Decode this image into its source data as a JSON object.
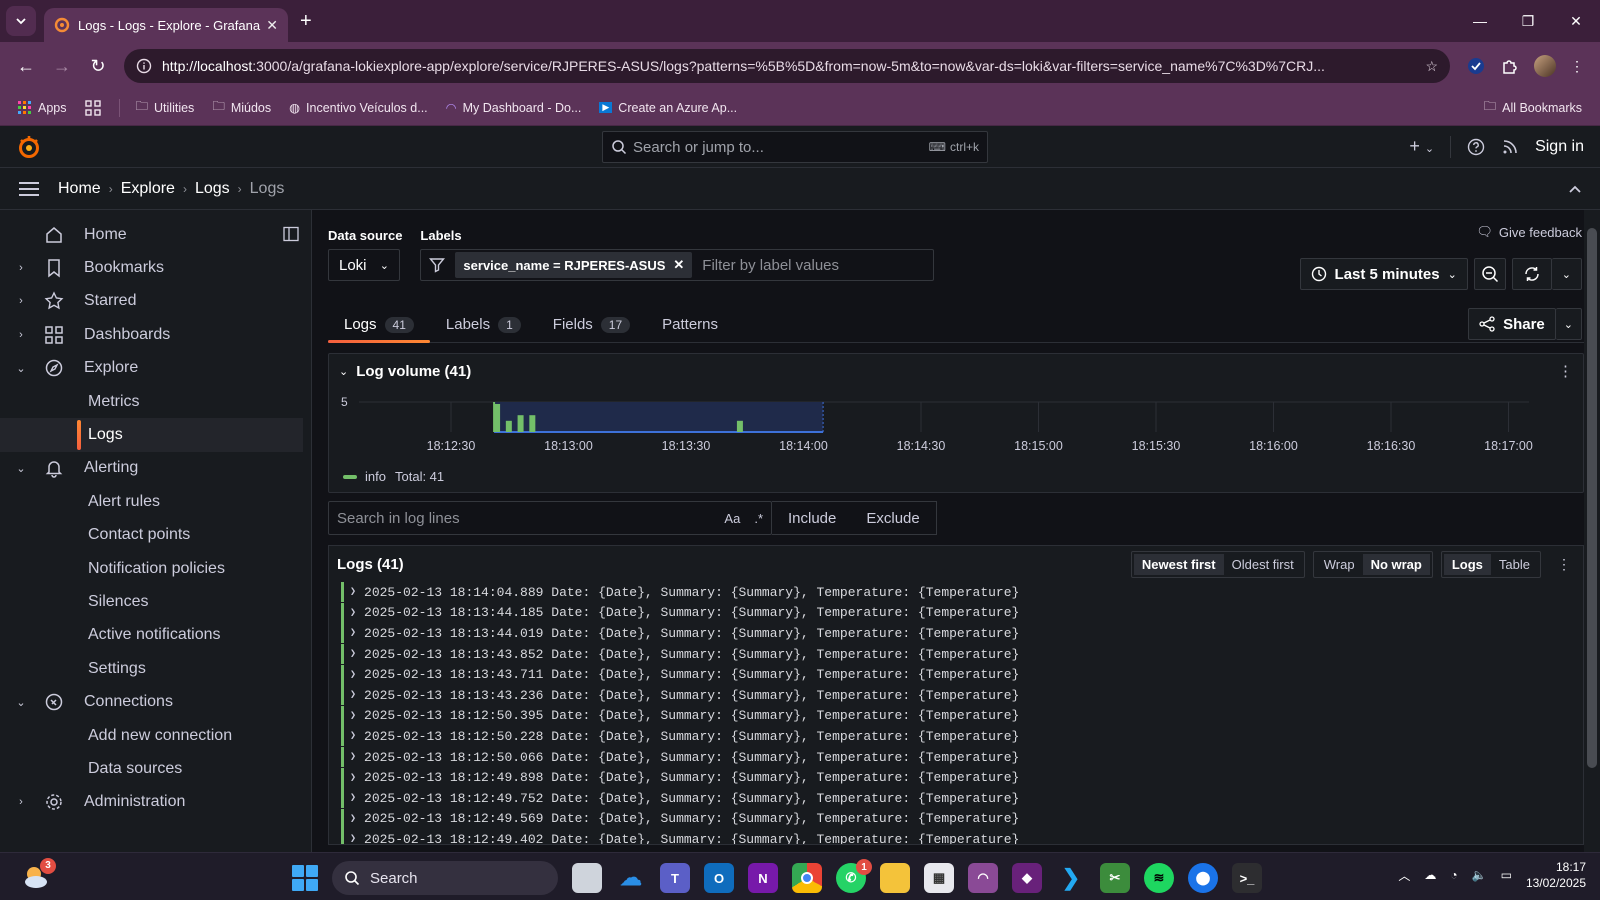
{
  "browser": {
    "tab_title": "Logs - Logs - Explore - Grafana",
    "url_host": "http://localhost",
    "url_rest": ":3000/a/grafana-lokiexplore-app/explore/service/RJPERES-ASUS/logs?patterns=%5B%5D&from=now-5m&to=now&var-ds=loki&var-filters=service_name%7C%3D%7CRJ...",
    "bookmarks": [
      "Apps",
      "Utilities",
      "Miúdos",
      "Incentivo Veículos d...",
      "My Dashboard - Do...",
      "Create an Azure Ap..."
    ],
    "all_bookmarks": "All Bookmarks"
  },
  "header": {
    "search_placeholder": "Search or jump to...",
    "shortcut": "ctrl+k",
    "sign_in": "Sign in"
  },
  "breadcrumb": [
    "Home",
    "Explore",
    "Logs",
    "Logs"
  ],
  "sidebar": {
    "items": [
      {
        "label": "Home",
        "icon": "home-icon",
        "chev": ""
      },
      {
        "label": "Bookmarks",
        "icon": "bookmark-icon",
        "chev": "›"
      },
      {
        "label": "Starred",
        "icon": "star-icon",
        "chev": "›"
      },
      {
        "label": "Dashboards",
        "icon": "apps-icon",
        "chev": "›"
      },
      {
        "label": "Explore",
        "icon": "compass-icon",
        "chev": "⌄"
      },
      {
        "label": "Metrics",
        "sub": true
      },
      {
        "label": "Logs",
        "sub": true,
        "active": true
      },
      {
        "label": "Alerting",
        "icon": "bell-icon",
        "chev": "⌄"
      },
      {
        "label": "Alert rules",
        "sub": true
      },
      {
        "label": "Contact points",
        "sub": true
      },
      {
        "label": "Notification policies",
        "sub": true
      },
      {
        "label": "Silences",
        "sub": true
      },
      {
        "label": "Active notifications",
        "sub": true
      },
      {
        "label": "Settings",
        "sub": true
      },
      {
        "label": "Connections",
        "icon": "plug-icon",
        "chev": "⌄"
      },
      {
        "label": "Add new connection",
        "sub": true
      },
      {
        "label": "Data sources",
        "sub": true
      },
      {
        "label": "Administration",
        "icon": "cog-icon",
        "chev": "›"
      }
    ]
  },
  "main": {
    "give_feedback": "Give feedback",
    "datasource_label": "Data source",
    "datasource_value": "Loki",
    "labels_label": "Labels",
    "filter_chip": "service_name = RJPERES-ASUS",
    "filter_placeholder": "Filter by label values",
    "time_range": "Last 5 minutes",
    "share": "Share",
    "tabs": [
      {
        "label": "Logs",
        "count": "41",
        "active": true
      },
      {
        "label": "Labels",
        "count": "1"
      },
      {
        "label": "Fields",
        "count": "17"
      },
      {
        "label": "Patterns",
        "count": ""
      }
    ],
    "volume_title": "Log volume (41)",
    "legend_label": "info",
    "legend_total": "Total: 41",
    "log_search_placeholder": "Search in log lines",
    "aa": "Aa",
    "regex": ".*",
    "include": "Include",
    "exclude": "Exclude",
    "logs_title": "Logs (41)",
    "sort_newest": "Newest first",
    "sort_oldest": "Oldest first",
    "wrap": "Wrap",
    "nowrap": "No wrap",
    "view_logs": "Logs",
    "view_table": "Table",
    "log_lines": [
      "2025-02-13 18:14:04.889 Date: {Date}, Summary: {Summary}, Temperature: {Temperature}",
      "2025-02-13 18:13:44.185 Date: {Date}, Summary: {Summary}, Temperature: {Temperature}",
      "2025-02-13 18:13:44.019 Date: {Date}, Summary: {Summary}, Temperature: {Temperature}",
      "2025-02-13 18:13:43.852 Date: {Date}, Summary: {Summary}, Temperature: {Temperature}",
      "2025-02-13 18:13:43.711 Date: {Date}, Summary: {Summary}, Temperature: {Temperature}",
      "2025-02-13 18:13:43.236 Date: {Date}, Summary: {Summary}, Temperature: {Temperature}",
      "2025-02-13 18:12:50.395 Date: {Date}, Summary: {Summary}, Temperature: {Temperature}",
      "2025-02-13 18:12:50.228 Date: {Date}, Summary: {Summary}, Temperature: {Temperature}",
      "2025-02-13 18:12:50.066 Date: {Date}, Summary: {Summary}, Temperature: {Temperature}",
      "2025-02-13 18:12:49.898 Date: {Date}, Summary: {Summary}, Temperature: {Temperature}",
      "2025-02-13 18:12:49.752 Date: {Date}, Summary: {Summary}, Temperature: {Temperature}",
      "2025-02-13 18:12:49.569 Date: {Date}, Summary: {Summary}, Temperature: {Temperature}",
      "2025-02-13 18:12:49.402 Date: {Date}, Summary: {Summary}, Temperature: {Temperature}"
    ]
  },
  "chart_data": {
    "type": "bar",
    "y_tick": "5",
    "x_ticks": [
      "18:12:30",
      "18:13:00",
      "18:13:30",
      "18:14:00",
      "18:14:30",
      "18:15:00",
      "18:15:30",
      "18:16:00",
      "18:16:30",
      "18:17:00"
    ],
    "series": [
      {
        "name": "info",
        "color": "#73bf69"
      }
    ],
    "selection": [
      "18:12:41",
      "18:14:05"
    ],
    "bars": [
      {
        "t": "18:12:41",
        "v": 5
      },
      {
        "t": "18:12:44",
        "v": 2
      },
      {
        "t": "18:12:47",
        "v": 3
      },
      {
        "t": "18:12:50",
        "v": 3
      },
      {
        "t": "18:13:43",
        "v": 2
      }
    ],
    "ymax": 5
  },
  "taskbar": {
    "search": "Search",
    "time": "18:17",
    "date": "13/02/2025",
    "weather_badge": "3",
    "whatsapp_badge": "1"
  },
  "colors": {
    "accent": "#f55f3e",
    "info": "#73bf69",
    "selection": "#1f2a4a"
  }
}
